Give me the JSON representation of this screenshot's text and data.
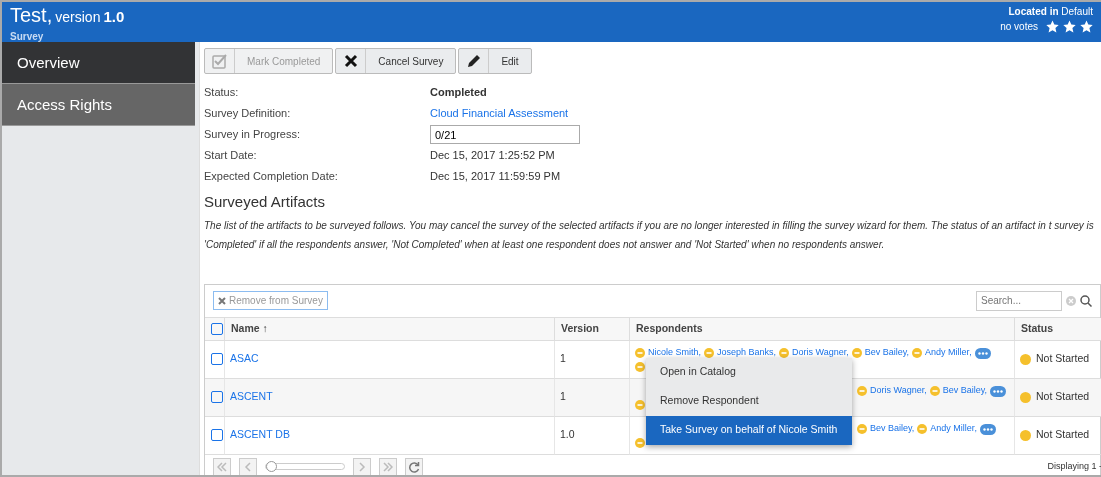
{
  "header": {
    "title_name": "Test,",
    "version_label": "version",
    "version_number": "1.0",
    "subtitle": "Survey",
    "location": "**Located in** Default",
    "votes": "no votes"
  },
  "sidebar": {
    "items": [
      {
        "label": "Overview",
        "selected": true
      },
      {
        "label": "Access Rights",
        "selected": false
      }
    ]
  },
  "toolbar": [
    {
      "label": "Mark Completed",
      "disabled": true
    },
    {
      "label": "Cancel Survey",
      "disabled": false
    },
    {
      "label": "Edit",
      "disabled": false
    }
  ],
  "fields": [
    {
      "label": "Status:",
      "value": "Completed",
      "kind": "bold"
    },
    {
      "label": "Survey Definition:",
      "value": "Cloud Financial Assessment",
      "kind": "link"
    },
    {
      "label": "Survey in Progress:",
      "value": "0/21",
      "kind": "input"
    },
    {
      "label": "Start Date:",
      "value": "Dec 15, 2017 1:25:52 PM",
      "kind": "text"
    },
    {
      "label": "Expected Completion Date:",
      "value": "Dec 15, 2017 11:59:59 PM",
      "kind": "text"
    }
  ],
  "section": {
    "title": "Surveyed Artifacts",
    "description": "The list of the artifacts to be surveyed follows. You may cancel the survey of the selected artifacts if you are no longer interested in filling the survey wizard for them. The status of an artifact in t survey is 'Completed' if all the respondents answer, 'Not Completed' when at least one respondent does not answer and 'Not Started' when no respondents answer."
  },
  "grid": {
    "remove_button": {
      "label": "Remove from Survey",
      "disabled": true
    },
    "search": {
      "placeholder": "Search..."
    },
    "select_all_checked": false,
    "columns": [
      "Name ↑",
      "Version",
      "Respondents",
      "Status"
    ],
    "rows": [
      {
        "name": "ASAC",
        "version": "1",
        "respondents": [
          "Nicole Smith,",
          "Joseph Banks,",
          "Doris Wagner,",
          "Bev Bailey,",
          "Andy Miller,"
        ],
        "status": "Not Started",
        "checked": false
      },
      {
        "name": "ASCENT",
        "version": "1",
        "respondents": [
          "Doris Wagner,",
          "Bev Bailey,"
        ],
        "status": "Not Started",
        "checked": false
      },
      {
        "name": "ASCENT DB",
        "version": "1.0",
        "respondents": [
          "Bev Bailey,",
          "Andy Miller,"
        ],
        "status": "Not Started",
        "checked": false
      }
    ],
    "pager": {
      "level": 0,
      "display": "Displaying 1 -"
    }
  },
  "context_menu": [
    {
      "label": "Open in Catalog",
      "selected": false
    },
    {
      "label": "Remove Respondent",
      "selected": false
    },
    {
      "label": "Take Survey on behalf of Nicole Smith",
      "selected": true
    }
  ]
}
